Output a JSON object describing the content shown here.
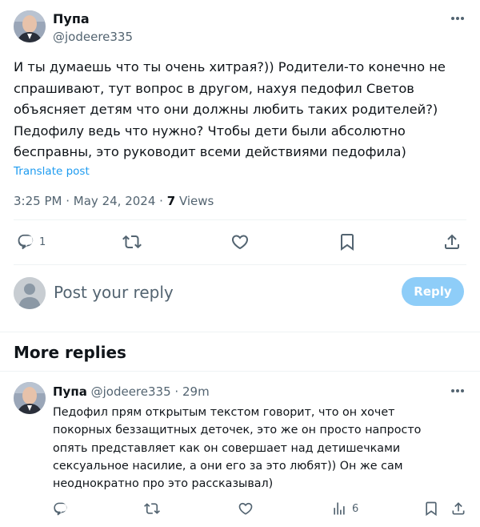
{
  "main_post": {
    "author": {
      "name": "Пупа",
      "handle": "@jodeere335"
    },
    "text": "И ты думаешь что ты очень хитрая?)) Родители-то конечно не спрашивают, тут вопрос в другом, нахуя педофил Светов объясняет детям что они должны любить таких родителей?) Педофилу ведь что нужно? Чтобы дети были абсолютно бесправны, это руководит всеми действиями педофила)",
    "translate_label": "Translate post",
    "time": "3:25 PM",
    "date": "May 24, 2024",
    "views_count": "7",
    "views_label": "Views",
    "separator": "·",
    "actions": {
      "reply_count": "1",
      "reply_icon": "reply-icon",
      "repost_icon": "repost-icon",
      "like_icon": "like-icon",
      "bookmark_icon": "bookmark-icon",
      "share_icon": "share-icon"
    }
  },
  "reply_composer": {
    "placeholder": "Post your reply",
    "button_label": "Reply",
    "button_color": "#8ecdf8"
  },
  "more_replies": {
    "title": "More replies",
    "items": [
      {
        "name": "Пупа",
        "handle": "@jodeere335",
        "separator": "·",
        "time": "29m",
        "text": "Педофил прям открытым текстом говорит, что он хочет покорных беззащитных деточек, это же он просто напросто опять представляет как он совершает над детишечками сексуальное насилие, а они его за это любят)) Он же сам неоднократно про это рассказывал)",
        "views_count": "6"
      }
    ]
  },
  "colors": {
    "text_primary": "#0f1419",
    "text_secondary": "#536471",
    "link": "#1d9bf0",
    "divider": "#eff3f4"
  }
}
